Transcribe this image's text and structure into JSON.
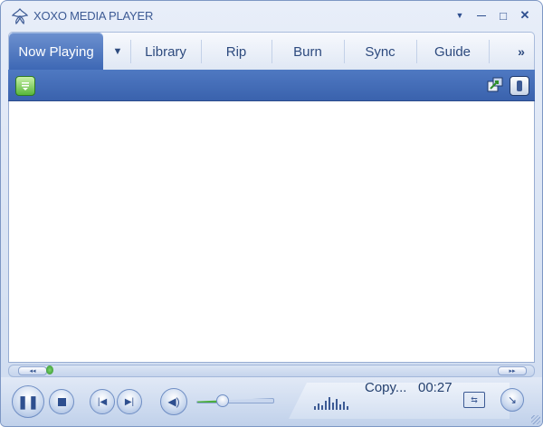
{
  "window": {
    "title": "XOXO MEDIA PLAYER"
  },
  "tabs": [
    {
      "label": "Now Playing",
      "active": true
    },
    {
      "label": "Library"
    },
    {
      "label": "Rip"
    },
    {
      "label": "Burn"
    },
    {
      "label": "Sync"
    },
    {
      "label": "Guide"
    }
  ],
  "window_controls": {
    "menu": "▼",
    "minimize": "—",
    "maximize": "□",
    "close": "✕"
  },
  "tab_more": "»",
  "status": {
    "text": "Copy...",
    "time": "00:27"
  },
  "icons": {
    "logo": "xoxo-logo-icon",
    "options": "list-options-icon",
    "switch_view": "switch-view-icon",
    "shuffle": "shuffle-icon",
    "pause": "pause-icon",
    "stop": "stop-icon",
    "previous": "previous-icon",
    "next": "next-icon",
    "mute": "speaker-icon",
    "compact": "compact-mode-icon"
  },
  "volume_level": 0.3,
  "seek_position": 0.07,
  "colors": {
    "accent": "#3c67b4",
    "toolbar": "#4a73bd",
    "text": "#2d4a7e"
  }
}
